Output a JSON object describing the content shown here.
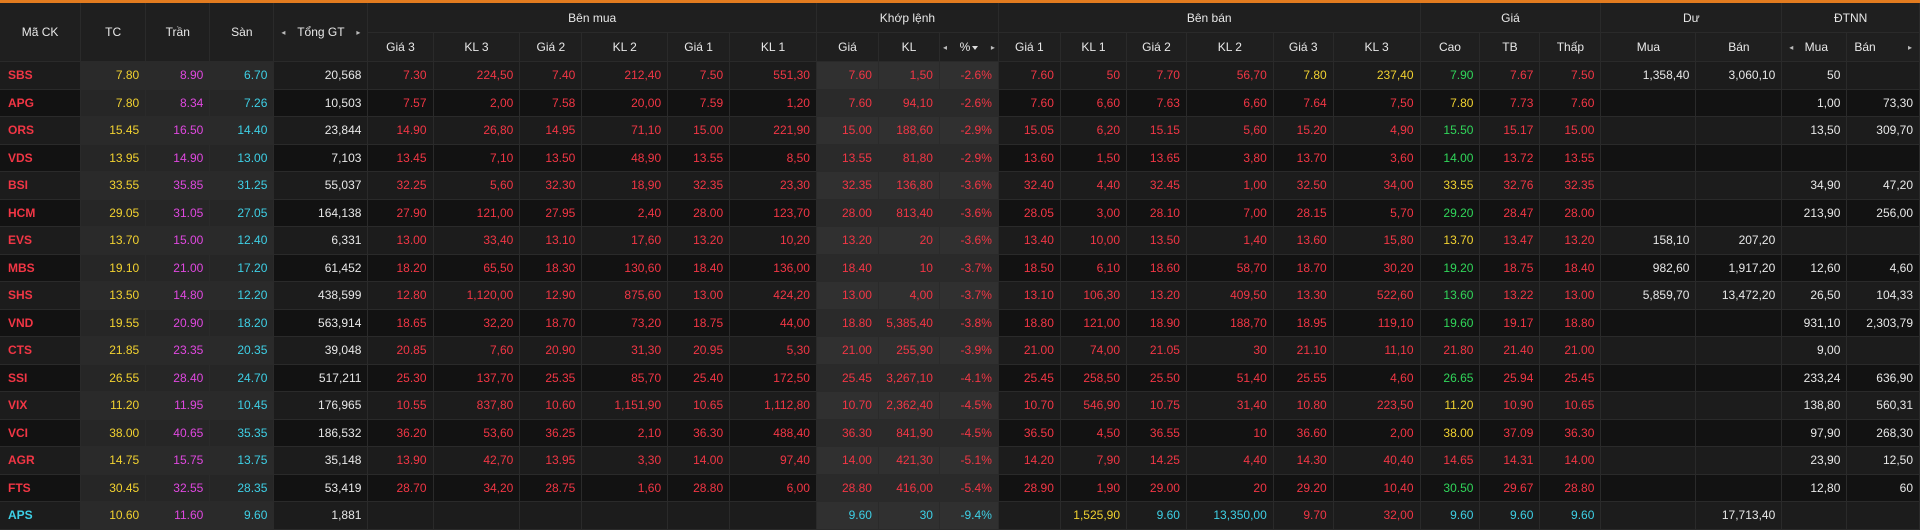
{
  "colors": {
    "up": "#30d65a",
    "down": "#f23645",
    "ref": "#f2d230",
    "ceil": "#e048e0",
    "floor": "#3ed0e6",
    "accent": "#e27b1f"
  },
  "headers": {
    "symbol": "Mã CK",
    "tc": "TC",
    "tran": "Trần",
    "san": "Sàn",
    "tong_gt": "Tổng GT",
    "ben_mua": "Bên mua",
    "khop_lenh": "Khớp lệnh",
    "ben_ban": "Bên bán",
    "gia": "Giá",
    "du": "Dư",
    "dtnn": "ĐTNN",
    "gia3": "Giá 3",
    "kl3": "KL 3",
    "gia2": "Giá 2",
    "kl2": "KL 2",
    "gia1": "Giá 1",
    "kl1": "KL 1",
    "kl_gia": "Giá",
    "kl_kl": "KL",
    "kl_pct": "%",
    "cao": "Cao",
    "tb": "TB",
    "thap": "Thấp",
    "du_mua": "Mua",
    "du_ban": "Bán",
    "nn_mua": "Mua",
    "nn_ban": "Bán",
    "left_arrow_icon": "◂",
    "right_arrow_icon": "▸"
  },
  "rows": [
    {
      "sym": "SBS",
      "sc": "dn",
      "tc": "7.80",
      "tran": "8.90",
      "san": "6.70",
      "gt": "20,568",
      "b3": "7.30",
      "bk3": "224,50",
      "b3c": "dn",
      "b2": "7.40",
      "bk2": "212,40",
      "b2c": "dn",
      "b1": "7.50",
      "bk1": "551,30",
      "b1c": "dn",
      "m": "7.60",
      "mk": "1,50",
      "mp": "-2.6%",
      "mc": "dn",
      "s1": "7.60",
      "sk1": "50",
      "s1c": "dn",
      "s2": "7.70",
      "sk2": "56,70",
      "s2c": "dn",
      "s3": "7.80",
      "sk3": "237,40",
      "s3c": "ref-c",
      "hi": "7.90",
      "hic": "up",
      "avg": "7.67",
      "avgc": "dn",
      "lo": "7.50",
      "loc": "dn",
      "dm": "1,358,40",
      "db": "3,060,10",
      "nm": "50",
      "nb": ""
    },
    {
      "sym": "APG",
      "sc": "dn",
      "tc": "7.80",
      "tran": "8.34",
      "san": "7.26",
      "gt": "10,503",
      "b3": "7.57",
      "bk3": "2,00",
      "b3c": "dn",
      "b2": "7.58",
      "bk2": "20,00",
      "b2c": "dn",
      "b1": "7.59",
      "bk1": "1,20",
      "b1c": "dn",
      "m": "7.60",
      "mk": "94,10",
      "mp": "-2.6%",
      "mc": "dn",
      "s1": "7.60",
      "sk1": "6,60",
      "s1c": "dn",
      "s2": "7.63",
      "sk2": "6,60",
      "s2c": "dn",
      "s3": "7.64",
      "sk3": "7,50",
      "s3c": "dn",
      "hi": "7.80",
      "hic": "ref-c",
      "avg": "7.73",
      "avgc": "dn",
      "lo": "7.60",
      "loc": "dn",
      "dm": "",
      "db": "",
      "nm": "1,00",
      "nb": "73,30"
    },
    {
      "sym": "ORS",
      "sc": "dn",
      "tc": "15.45",
      "tran": "16.50",
      "san": "14.40",
      "gt": "23,844",
      "b3": "14.90",
      "bk3": "26,80",
      "b3c": "dn",
      "b2": "14.95",
      "bk2": "71,10",
      "b2c": "dn",
      "b1": "15.00",
      "bk1": "221,90",
      "b1c": "dn",
      "m": "15.00",
      "mk": "188,60",
      "mp": "-2.9%",
      "mc": "dn",
      "s1": "15.05",
      "sk1": "6,20",
      "s1c": "dn",
      "s2": "15.15",
      "sk2": "5,60",
      "s2c": "dn",
      "s3": "15.20",
      "sk3": "4,90",
      "s3c": "dn",
      "hi": "15.50",
      "hic": "up",
      "avg": "15.17",
      "avgc": "dn",
      "lo": "15.00",
      "loc": "dn",
      "dm": "",
      "db": "",
      "nm": "13,50",
      "nb": "309,70"
    },
    {
      "sym": "VDS",
      "sc": "dn",
      "tc": "13.95",
      "tran": "14.90",
      "san": "13.00",
      "gt": "7,103",
      "b3": "13.45",
      "bk3": "7,10",
      "b3c": "dn",
      "b2": "13.50",
      "bk2": "48,90",
      "b2c": "dn",
      "b1": "13.55",
      "bk1": "8,50",
      "b1c": "dn",
      "m": "13.55",
      "mk": "81,80",
      "mp": "-2.9%",
      "mc": "dn",
      "s1": "13.60",
      "sk1": "1,50",
      "s1c": "dn",
      "s2": "13.65",
      "sk2": "3,80",
      "s2c": "dn",
      "s3": "13.70",
      "sk3": "3,60",
      "s3c": "dn",
      "hi": "14.00",
      "hic": "up",
      "avg": "13.72",
      "avgc": "dn",
      "lo": "13.55",
      "loc": "dn",
      "dm": "",
      "db": "",
      "nm": "",
      "nb": ""
    },
    {
      "sym": "BSI",
      "sc": "dn",
      "tc": "33.55",
      "tran": "35.85",
      "san": "31.25",
      "gt": "55,037",
      "b3": "32.25",
      "bk3": "5,60",
      "b3c": "dn",
      "b2": "32.30",
      "bk2": "18,90",
      "b2c": "dn",
      "b1": "32.35",
      "bk1": "23,30",
      "b1c": "dn",
      "m": "32.35",
      "mk": "136,80",
      "mp": "-3.6%",
      "mc": "dn",
      "s1": "32.40",
      "sk1": "4,40",
      "s1c": "dn",
      "s2": "32.45",
      "sk2": "1,00",
      "s2c": "dn",
      "s3": "32.50",
      "sk3": "34,00",
      "s3c": "dn",
      "hi": "33.55",
      "hic": "ref-c",
      "avg": "32.76",
      "avgc": "dn",
      "lo": "32.35",
      "loc": "dn",
      "dm": "",
      "db": "",
      "nm": "34,90",
      "nb": "47,20"
    },
    {
      "sym": "HCM",
      "sc": "dn",
      "tc": "29.05",
      "tran": "31.05",
      "san": "27.05",
      "gt": "164,138",
      "b3": "27.90",
      "bk3": "121,00",
      "b3c": "dn",
      "b2": "27.95",
      "bk2": "2,40",
      "b2c": "dn",
      "b1": "28.00",
      "bk1": "123,70",
      "b1c": "dn",
      "m": "28.00",
      "mk": "813,40",
      "mp": "-3.6%",
      "mc": "dn",
      "s1": "28.05",
      "sk1": "3,00",
      "s1c": "dn",
      "s2": "28.10",
      "sk2": "7,00",
      "s2c": "dn",
      "s3": "28.15",
      "sk3": "5,70",
      "s3c": "dn",
      "hi": "29.20",
      "hic": "up",
      "avg": "28.47",
      "avgc": "dn",
      "lo": "28.00",
      "loc": "dn",
      "dm": "",
      "db": "",
      "nm": "213,90",
      "nb": "256,00"
    },
    {
      "sym": "EVS",
      "sc": "dn",
      "tc": "13.70",
      "tran": "15.00",
      "san": "12.40",
      "gt": "6,331",
      "b3": "13.00",
      "bk3": "33,40",
      "b3c": "dn",
      "b2": "13.10",
      "bk2": "17,60",
      "b2c": "dn",
      "b1": "13.20",
      "bk1": "10,20",
      "b1c": "dn",
      "m": "13.20",
      "mk": "20",
      "mp": "-3.6%",
      "mc": "dn",
      "s1": "13.40",
      "sk1": "10,00",
      "s1c": "dn",
      "s2": "13.50",
      "sk2": "1,40",
      "s2c": "dn",
      "s3": "13.60",
      "sk3": "15,80",
      "s3c": "dn",
      "hi": "13.70",
      "hic": "ref-c",
      "avg": "13.47",
      "avgc": "dn",
      "lo": "13.20",
      "loc": "dn",
      "dm": "158,10",
      "db": "207,20",
      "nm": "",
      "nb": ""
    },
    {
      "sym": "MBS",
      "sc": "dn",
      "tc": "19.10",
      "tran": "21.00",
      "san": "17.20",
      "gt": "61,452",
      "b3": "18.20",
      "bk3": "65,50",
      "b3c": "dn",
      "b2": "18.30",
      "bk2": "130,60",
      "b2c": "dn",
      "b1": "18.40",
      "bk1": "136,00",
      "b1c": "dn",
      "m": "18.40",
      "mk": "10",
      "mp": "-3.7%",
      "mc": "dn",
      "s1": "18.50",
      "sk1": "6,10",
      "s1c": "dn",
      "s2": "18.60",
      "sk2": "58,70",
      "s2c": "dn",
      "s3": "18.70",
      "sk3": "30,20",
      "s3c": "dn",
      "hi": "19.20",
      "hic": "up",
      "avg": "18.75",
      "avgc": "dn",
      "lo": "18.40",
      "loc": "dn",
      "dm": "982,60",
      "db": "1,917,20",
      "nm": "12,60",
      "nb": "4,60"
    },
    {
      "sym": "SHS",
      "sc": "dn",
      "tc": "13.50",
      "tran": "14.80",
      "san": "12.20",
      "gt": "438,599",
      "b3": "12.80",
      "bk3": "1,120,00",
      "b3c": "dn",
      "b2": "12.90",
      "bk2": "875,60",
      "b2c": "dn",
      "b1": "13.00",
      "bk1": "424,20",
      "b1c": "dn",
      "m": "13.00",
      "mk": "4,00",
      "mp": "-3.7%",
      "mc": "dn",
      "s1": "13.10",
      "sk1": "106,30",
      "s1c": "dn",
      "s2": "13.20",
      "sk2": "409,50",
      "s2c": "dn",
      "s3": "13.30",
      "sk3": "522,60",
      "s3c": "dn",
      "hi": "13.60",
      "hic": "up",
      "avg": "13.22",
      "avgc": "dn",
      "lo": "13.00",
      "loc": "dn",
      "dm": "5,859,70",
      "db": "13,472,20",
      "nm": "26,50",
      "nb": "104,33"
    },
    {
      "sym": "VND",
      "sc": "dn",
      "tc": "19.55",
      "tran": "20.90",
      "san": "18.20",
      "gt": "563,914",
      "b3": "18.65",
      "bk3": "32,20",
      "b3c": "dn",
      "b2": "18.70",
      "bk2": "73,20",
      "b2c": "dn",
      "b1": "18.75",
      "bk1": "44,00",
      "b1c": "dn",
      "m": "18.80",
      "mk": "5,385,40",
      "mp": "-3.8%",
      "mc": "dn",
      "s1": "18.80",
      "sk1": "121,00",
      "s1c": "dn",
      "s2": "18.90",
      "sk2": "188,70",
      "s2c": "dn",
      "s3": "18.95",
      "sk3": "119,10",
      "s3c": "dn",
      "hi": "19.60",
      "hic": "up",
      "avg": "19.17",
      "avgc": "dn",
      "lo": "18.80",
      "loc": "dn",
      "dm": "",
      "db": "",
      "nm": "931,10",
      "nb": "2,303,79"
    },
    {
      "sym": "CTS",
      "sc": "dn",
      "tc": "21.85",
      "tran": "23.35",
      "san": "20.35",
      "gt": "39,048",
      "b3": "20.85",
      "bk3": "7,60",
      "b3c": "dn",
      "b2": "20.90",
      "bk2": "31,30",
      "b2c": "dn",
      "b1": "20.95",
      "bk1": "5,30",
      "b1c": "dn",
      "m": "21.00",
      "mk": "255,90",
      "mp": "-3.9%",
      "mc": "dn",
      "s1": "21.00",
      "sk1": "74,00",
      "s1c": "dn",
      "s2": "21.05",
      "sk2": "30",
      "s2c": "dn",
      "s3": "21.10",
      "sk3": "11,10",
      "s3c": "dn",
      "hi": "21.80",
      "hic": "dn",
      "avg": "21.40",
      "avgc": "dn",
      "lo": "21.00",
      "loc": "dn",
      "dm": "",
      "db": "",
      "nm": "9,00",
      "nb": ""
    },
    {
      "sym": "SSI",
      "sc": "dn",
      "tc": "26.55",
      "tran": "28.40",
      "san": "24.70",
      "gt": "517,211",
      "b3": "25.30",
      "bk3": "137,70",
      "b3c": "dn",
      "b2": "25.35",
      "bk2": "85,70",
      "b2c": "dn",
      "b1": "25.40",
      "bk1": "172,50",
      "b1c": "dn",
      "m": "25.45",
      "mk": "3,267,10",
      "mp": "-4.1%",
      "mc": "dn",
      "s1": "25.45",
      "sk1": "258,50",
      "s1c": "dn",
      "s2": "25.50",
      "sk2": "51,40",
      "s2c": "dn",
      "s3": "25.55",
      "sk3": "4,60",
      "s3c": "dn",
      "hi": "26.65",
      "hic": "up",
      "avg": "25.94",
      "avgc": "dn",
      "lo": "25.45",
      "loc": "dn",
      "dm": "",
      "db": "",
      "nm": "233,24",
      "nb": "636,90"
    },
    {
      "sym": "VIX",
      "sc": "dn",
      "tc": "11.20",
      "tran": "11.95",
      "san": "10.45",
      "gt": "176,965",
      "b3": "10.55",
      "bk3": "837,80",
      "b3c": "dn",
      "b2": "10.60",
      "bk2": "1,151,90",
      "b2c": "dn",
      "b1": "10.65",
      "bk1": "1,112,80",
      "b1c": "dn",
      "m": "10.70",
      "mk": "2,362,40",
      "mp": "-4.5%",
      "mc": "dn",
      "s1": "10.70",
      "sk1": "546,90",
      "s1c": "dn",
      "s2": "10.75",
      "sk2": "31,40",
      "s2c": "dn",
      "s3": "10.80",
      "sk3": "223,50",
      "s3c": "dn",
      "hi": "11.20",
      "hic": "ref-c",
      "avg": "10.90",
      "avgc": "dn",
      "lo": "10.65",
      "loc": "dn",
      "dm": "",
      "db": "",
      "nm": "138,80",
      "nb": "560,31"
    },
    {
      "sym": "VCI",
      "sc": "dn",
      "tc": "38.00",
      "tran": "40.65",
      "san": "35.35",
      "gt": "186,532",
      "b3": "36.20",
      "bk3": "53,60",
      "b3c": "dn",
      "b2": "36.25",
      "bk2": "2,10",
      "b2c": "dn",
      "b1": "36.30",
      "bk1": "488,40",
      "b1c": "dn",
      "m": "36.30",
      "mk": "841,90",
      "mp": "-4.5%",
      "mc": "dn",
      "s1": "36.50",
      "sk1": "4,50",
      "s1c": "dn",
      "s2": "36.55",
      "sk2": "10",
      "s2c": "dn",
      "s3": "36.60",
      "sk3": "2,00",
      "s3c": "dn",
      "hi": "38.00",
      "hic": "ref-c",
      "avg": "37.09",
      "avgc": "dn",
      "lo": "36.30",
      "loc": "dn",
      "dm": "",
      "db": "",
      "nm": "97,90",
      "nb": "268,30"
    },
    {
      "sym": "AGR",
      "sc": "dn",
      "tc": "14.75",
      "tran": "15.75",
      "san": "13.75",
      "gt": "35,148",
      "b3": "13.90",
      "bk3": "42,70",
      "b3c": "dn",
      "b2": "13.95",
      "bk2": "3,30",
      "b2c": "dn",
      "b1": "14.00",
      "bk1": "97,40",
      "b1c": "dn",
      "m": "14.00",
      "mk": "421,30",
      "mp": "-5.1%",
      "mc": "dn",
      "s1": "14.20",
      "sk1": "7,90",
      "s1c": "dn",
      "s2": "14.25",
      "sk2": "4,40",
      "s2c": "dn",
      "s3": "14.30",
      "sk3": "40,40",
      "s3c": "dn",
      "hi": "14.65",
      "hic": "dn",
      "avg": "14.31",
      "avgc": "dn",
      "lo": "14.00",
      "loc": "dn",
      "dm": "",
      "db": "",
      "nm": "23,90",
      "nb": "12,50"
    },
    {
      "sym": "FTS",
      "sc": "dn",
      "tc": "30.45",
      "tran": "32.55",
      "san": "28.35",
      "gt": "53,419",
      "b3": "28.70",
      "bk3": "34,20",
      "b3c": "dn",
      "b2": "28.75",
      "bk2": "1,60",
      "b2c": "dn",
      "b1": "28.80",
      "bk1": "6,00",
      "b1c": "dn",
      "m": "28.80",
      "mk": "416,00",
      "mp": "-5.4%",
      "mc": "dn",
      "s1": "28.90",
      "sk1": "1,90",
      "s1c": "dn",
      "s2": "29.00",
      "sk2": "20",
      "s2c": "dn",
      "s3": "29.20",
      "sk3": "10,40",
      "s3c": "dn",
      "hi": "30.50",
      "hic": "up",
      "avg": "29.67",
      "avgc": "dn",
      "lo": "28.80",
      "loc": "dn",
      "dm": "",
      "db": "",
      "nm": "12,80",
      "nb": "60"
    },
    {
      "sym": "APS",
      "sc": "fl",
      "tc": "10.60",
      "tran": "11.60",
      "san": "9.60",
      "gt": "1,881",
      "b3": "",
      "bk3": "",
      "b3c": "dn",
      "b2": "",
      "bk2": "",
      "b2c": "dn",
      "b1": "",
      "bk1": "",
      "b1c": "dn",
      "m": "9.60",
      "mk": "30",
      "mp": "-9.4%",
      "mc": "fl",
      "s1": "",
      "sk1": "1,525,90",
      "s1c": "ref-c",
      "s2": "9.60",
      "sk2": "13,350,00",
      "s2c": "fl",
      "s3": "9.70",
      "sk3": "32,00",
      "s3c": "dn",
      "hi": "9.60",
      "hic": "fl",
      "avg": "9.60",
      "avgc": "fl",
      "lo": "9.60",
      "loc": "fl",
      "dm": "",
      "db": "17,713,40",
      "nm": "",
      "nb": ""
    }
  ]
}
